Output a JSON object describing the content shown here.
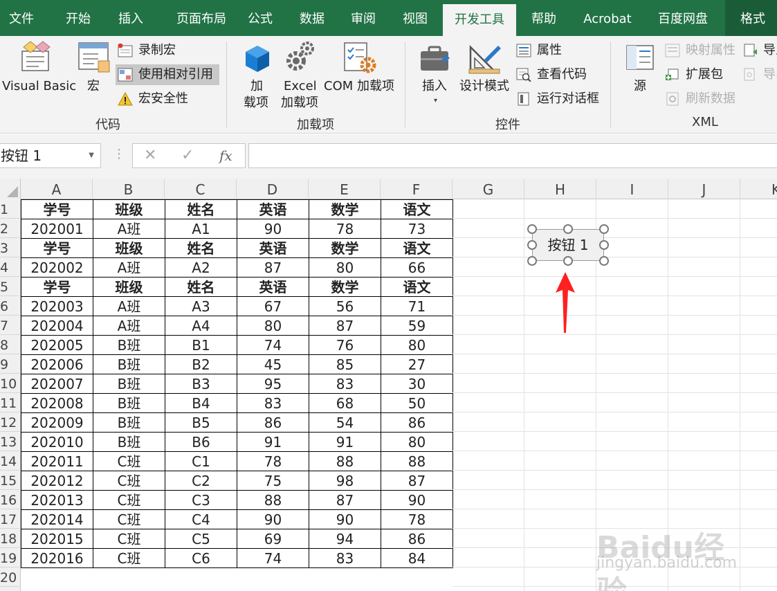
{
  "tabs": [
    "文件",
    "开始",
    "插入",
    "页面布局",
    "公式",
    "数据",
    "审阅",
    "视图",
    "开发工具",
    "帮助",
    "Acrobat",
    "百度网盘",
    "格式"
  ],
  "active_tab": "开发工具",
  "ribbon": {
    "code_group": {
      "label": "代码",
      "visual_basic": "Visual Basic",
      "macros": "宏",
      "record_macro": "录制宏",
      "use_relative_refs": "使用相对引用",
      "macro_security": "宏安全性"
    },
    "addins_group": {
      "label": "加载项",
      "addins_line1": "加",
      "addins_line2": "载项",
      "excel_addins_line1": "Excel",
      "excel_addins_line2": "加载项",
      "com_addins": "COM 加载项"
    },
    "controls_group": {
      "label": "控件",
      "insert": "插入",
      "design_mode": "设计模式",
      "properties": "属性",
      "view_code": "查看代码",
      "run_dialog": "运行对话框"
    },
    "xml_group": {
      "label": "XML",
      "source": "源",
      "map_properties": "映射属性",
      "expansion_packs": "扩展包",
      "refresh_data": "刷新数据",
      "import": "导入",
      "export": "导出"
    }
  },
  "formula_bar": {
    "name_box": "按钮 1",
    "cancel_glyph": "✕",
    "enter_glyph": "✓",
    "fx_glyph": "fx",
    "dots": "⋮",
    "value": ""
  },
  "columns": [
    "A",
    "B",
    "C",
    "D",
    "E",
    "F",
    "G",
    "H",
    "I",
    "J",
    "K"
  ],
  "rows": [
    "1",
    "2",
    "3",
    "4",
    "5",
    "6",
    "7",
    "8",
    "9",
    "10",
    "11",
    "12",
    "13",
    "14",
    "15",
    "16",
    "17",
    "18",
    "19",
    "20"
  ],
  "sheet": [
    [
      "学号",
      "班级",
      "姓名",
      "英语",
      "数学",
      "语文"
    ],
    [
      "202001",
      "A班",
      "A1",
      "90",
      "78",
      "73"
    ],
    [
      "学号",
      "班级",
      "姓名",
      "英语",
      "数学",
      "语文"
    ],
    [
      "202002",
      "A班",
      "A2",
      "87",
      "80",
      "66"
    ],
    [
      "学号",
      "班级",
      "姓名",
      "英语",
      "数学",
      "语文"
    ],
    [
      "202003",
      "A班",
      "A3",
      "67",
      "56",
      "71"
    ],
    [
      "202004",
      "A班",
      "A4",
      "80",
      "87",
      "59"
    ],
    [
      "202005",
      "B班",
      "B1",
      "74",
      "76",
      "80"
    ],
    [
      "202006",
      "B班",
      "B2",
      "45",
      "85",
      "27"
    ],
    [
      "202007",
      "B班",
      "B3",
      "95",
      "83",
      "30"
    ],
    [
      "202008",
      "B班",
      "B4",
      "83",
      "68",
      "50"
    ],
    [
      "202009",
      "B班",
      "B5",
      "86",
      "54",
      "86"
    ],
    [
      "202010",
      "B班",
      "B6",
      "91",
      "91",
      "80"
    ],
    [
      "202011",
      "C班",
      "C1",
      "78",
      "88",
      "88"
    ],
    [
      "202012",
      "C班",
      "C2",
      "75",
      "98",
      "87"
    ],
    [
      "202013",
      "C班",
      "C3",
      "88",
      "87",
      "90"
    ],
    [
      "202014",
      "C班",
      "C4",
      "90",
      "90",
      "78"
    ],
    [
      "202015",
      "C班",
      "C5",
      "69",
      "94",
      "86"
    ],
    [
      "202016",
      "C班",
      "C6",
      "74",
      "83",
      "84"
    ]
  ],
  "header_rows": [
    0,
    2,
    4
  ],
  "form_button": {
    "label": "按钮 1"
  },
  "annotation_color": "#ff2020",
  "accent_color": "#217346",
  "watermark": {
    "brand": "Baidu经验",
    "url": "jingyan.baidu.com"
  }
}
